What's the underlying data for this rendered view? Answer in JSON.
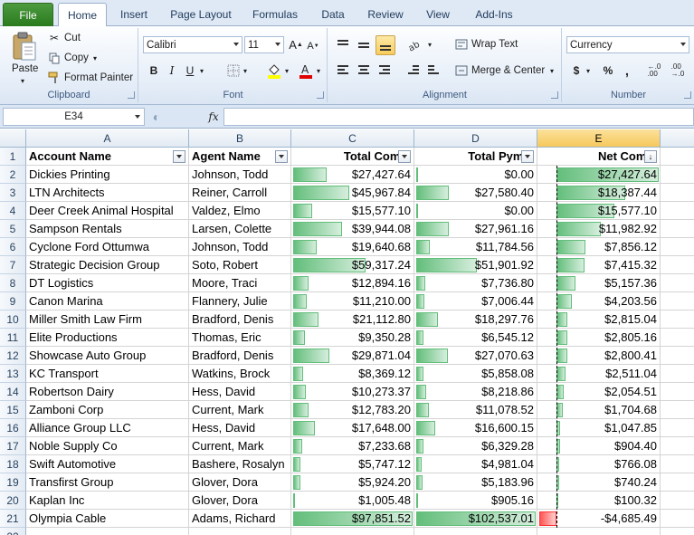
{
  "tabs": [
    "File",
    "Home",
    "Insert",
    "Page Layout",
    "Formulas",
    "Data",
    "Review",
    "View",
    "Add-Ins"
  ],
  "active_tab": "Home",
  "ribbon": {
    "clipboard": {
      "paste": "Paste",
      "cut": "Cut",
      "copy": "Copy",
      "format_painter": "Format Painter",
      "label": "Clipboard"
    },
    "font": {
      "name": "Calibri",
      "size": "11",
      "bold": "B",
      "italic": "I",
      "underline": "U",
      "label": "Font"
    },
    "alignment": {
      "wrap": "Wrap Text",
      "merge": "Merge & Center",
      "label": "Alignment"
    },
    "number": {
      "format": "Currency",
      "currency_symbol": "$",
      "percent": "%",
      "comma": ",",
      "label": "Number"
    }
  },
  "formula_bar": {
    "name_box": "E34",
    "fx": "fx",
    "content": ""
  },
  "columns": [
    "A",
    "B",
    "C",
    "D",
    "E"
  ],
  "selected_column": "E",
  "headers": [
    "Account Name",
    "Agent Name",
    "Total Comm",
    "Total Pymts",
    "Net Comm"
  ],
  "rows": [
    {
      "n": "1"
    },
    {
      "n": "2",
      "a": "Dickies Printing",
      "b": "Johnson, Todd",
      "c": "$27,427.64",
      "d": "$0.00",
      "e": "$27,427.64",
      "cv": 27427.64,
      "dv": 0,
      "ev": 27427.64
    },
    {
      "n": "3",
      "a": "LTN Architects",
      "b": "Reiner, Carroll",
      "c": "$45,967.84",
      "d": "$27,580.40",
      "e": "$18,387.44",
      "cv": 45967.84,
      "dv": 27580.4,
      "ev": 18387.44
    },
    {
      "n": "4",
      "a": "Deer Creek Animal Hospital",
      "b": "Valdez, Elmo",
      "c": "$15,577.10",
      "d": "$0.00",
      "e": "$15,577.10",
      "cv": 15577.1,
      "dv": 0,
      "ev": 15577.1
    },
    {
      "n": "5",
      "a": "Sampson Rentals",
      "b": "Larsen, Colette",
      "c": "$39,944.08",
      "d": "$27,961.16",
      "e": "$11,982.92",
      "cv": 39944.08,
      "dv": 27961.16,
      "ev": 11982.92
    },
    {
      "n": "6",
      "a": "Cyclone Ford Ottumwa",
      "b": "Johnson, Todd",
      "c": "$19,640.68",
      "d": "$11,784.56",
      "e": "$7,856.12",
      "cv": 19640.68,
      "dv": 11784.56,
      "ev": 7856.12
    },
    {
      "n": "7",
      "a": "Strategic Decision Group",
      "b": "Soto, Robert",
      "c": "$59,317.24",
      "d": "$51,901.92",
      "e": "$7,415.32",
      "cv": 59317.24,
      "dv": 51901.92,
      "ev": 7415.32
    },
    {
      "n": "8",
      "a": "DT Logistics",
      "b": "Moore, Traci",
      "c": "$12,894.16",
      "d": "$7,736.80",
      "e": "$5,157.36",
      "cv": 12894.16,
      "dv": 7736.8,
      "ev": 5157.36
    },
    {
      "n": "9",
      "a": "Canon Marina",
      "b": "Flannery, Julie",
      "c": "$11,210.00",
      "d": "$7,006.44",
      "e": "$4,203.56",
      "cv": 11210.0,
      "dv": 7006.44,
      "ev": 4203.56
    },
    {
      "n": "10",
      "a": "Miller Smith Law Firm",
      "b": "Bradford, Denis",
      "c": "$21,112.80",
      "d": "$18,297.76",
      "e": "$2,815.04",
      "cv": 21112.8,
      "dv": 18297.76,
      "ev": 2815.04
    },
    {
      "n": "11",
      "a": "Elite Productions",
      "b": "Thomas, Eric",
      "c": "$9,350.28",
      "d": "$6,545.12",
      "e": "$2,805.16",
      "cv": 9350.28,
      "dv": 6545.12,
      "ev": 2805.16
    },
    {
      "n": "12",
      "a": "Showcase Auto Group",
      "b": "Bradford, Denis",
      "c": "$29,871.04",
      "d": "$27,070.63",
      "e": "$2,800.41",
      "cv": 29871.04,
      "dv": 27070.63,
      "ev": 2800.41
    },
    {
      "n": "13",
      "a": "KC Transport",
      "b": "Watkins, Brock",
      "c": "$8,369.12",
      "d": "$5,858.08",
      "e": "$2,511.04",
      "cv": 8369.12,
      "dv": 5858.08,
      "ev": 2511.04
    },
    {
      "n": "14",
      "a": "Robertson Dairy",
      "b": "Hess, David",
      "c": "$10,273.37",
      "d": "$8,218.86",
      "e": "$2,054.51",
      "cv": 10273.37,
      "dv": 8218.86,
      "ev": 2054.51
    },
    {
      "n": "15",
      "a": "Zamboni Corp",
      "b": "Current, Mark",
      "c": "$12,783.20",
      "d": "$11,078.52",
      "e": "$1,704.68",
      "cv": 12783.2,
      "dv": 11078.52,
      "ev": 1704.68
    },
    {
      "n": "16",
      "a": "Alliance Group LLC",
      "b": "Hess, David",
      "c": "$17,648.00",
      "d": "$16,600.15",
      "e": "$1,047.85",
      "cv": 17648.0,
      "dv": 16600.15,
      "ev": 1047.85
    },
    {
      "n": "17",
      "a": "Noble Supply Co",
      "b": "Current, Mark",
      "c": "$7,233.68",
      "d": "$6,329.28",
      "e": "$904.40",
      "cv": 7233.68,
      "dv": 6329.28,
      "ev": 904.4
    },
    {
      "n": "18",
      "a": "Swift Automotive",
      "b": "Bashere, Rosalyn",
      "c": "$5,747.12",
      "d": "$4,981.04",
      "e": "$766.08",
      "cv": 5747.12,
      "dv": 4981.04,
      "ev": 766.08
    },
    {
      "n": "19",
      "a": "Transfirst Group",
      "b": "Glover, Dora",
      "c": "$5,924.20",
      "d": "$5,183.96",
      "e": "$740.24",
      "cv": 5924.2,
      "dv": 5183.96,
      "ev": 740.24
    },
    {
      "n": "20",
      "a": "Kaplan Inc",
      "b": "Glover, Dora",
      "c": "$1,005.48",
      "d": "$905.16",
      "e": "$100.32",
      "cv": 1005.48,
      "dv": 905.16,
      "ev": 100.32
    },
    {
      "n": "21",
      "a": "Olympia Cable",
      "b": "Adams, Richard",
      "c": "$97,851.52",
      "d": "$102,537.01",
      "e": "-$4,685.49",
      "cv": 97851.52,
      "dv": 102537.01,
      "ev": -4685.49
    },
    {
      "n": "22"
    }
  ],
  "colors": {
    "databar_green": "#63be7b",
    "databar_red": "#ff5555",
    "selected_header": "#f6c85c"
  }
}
